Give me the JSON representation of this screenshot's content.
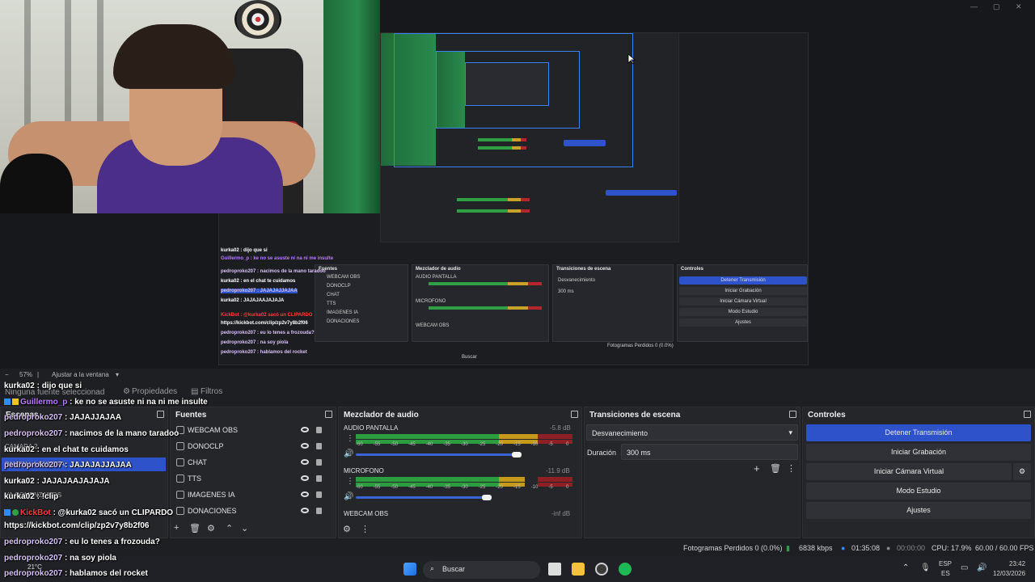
{
  "window": {
    "min": "—",
    "max": "▢",
    "close": "✕"
  },
  "zoom": {
    "level": "57%",
    "fit_label": "Ajustar a la ventana"
  },
  "tabs": {
    "properties": "Propiedades",
    "filters": "Filtros",
    "no_source": "Ninguna fuente seleccionad"
  },
  "docks": {
    "scenes": "Escenas",
    "sources": "Fuentes",
    "mixer": "Mezclador de audio",
    "transitions": "Transiciones de escena",
    "controls": "Controles"
  },
  "scenes_ghost": [
    "CAMARA 2",
    "PANTALLA ENTERA",
    "YA COMENZAMOS"
  ],
  "sources": [
    {
      "name": "WEBCAM OBS"
    },
    {
      "name": "DONOCLP"
    },
    {
      "name": "CHAT"
    },
    {
      "name": "TTS"
    },
    {
      "name": "IMAGENES IA"
    },
    {
      "name": "DONACIONES"
    }
  ],
  "mixer": {
    "channels": [
      {
        "name": "AUDIO PANTALLA",
        "db": "-5.8 dB",
        "level": 0.88
      },
      {
        "name": "MICROFONO",
        "db": "-11.9 dB",
        "level": 0.78
      },
      {
        "name": "WEBCAM OBS",
        "db": "-inf dB",
        "level": 0
      }
    ],
    "scale": [
      "-60",
      "-55",
      "-50",
      "-45",
      "-40",
      "-35",
      "-30",
      "-25",
      "-20",
      "-15",
      "-10",
      "-5",
      "0"
    ]
  },
  "transitions": {
    "type": "Desvanecimiento",
    "duration_label": "Duración",
    "duration": "300 ms"
  },
  "controls": {
    "stop_stream": "Detener Transmisión",
    "start_rec": "Iniciar Grabación",
    "virtual_cam": "Iniciar Cámara Virtual",
    "studio": "Modo Estudio",
    "settings": "Ajustes"
  },
  "status": {
    "dropped": "Fotogramas Perdidos 0 (0.0%)",
    "kbps": "6838 kbps",
    "stream_time": "01:35:08",
    "rec_time": "00:00:00",
    "cpu": "CPU: 17.9%",
    "fps": "60.00 / 60.00 FPS"
  },
  "taskbar": {
    "search": "Buscar",
    "weather": "21°C",
    "lang1": "ESP",
    "lang2": "ES",
    "time": "23:42",
    "date": "12/03/2026"
  },
  "chat": [
    {
      "user": "kurka02",
      "msg": ": dijo que si",
      "color": "white"
    },
    {
      "user": "Guillermo_p",
      "msg": ": ke no se asuste ni na ni me insulte",
      "color": "purple",
      "badges": true
    },
    {
      "user": "pedroproko207",
      "msg": ": JAJAJJAJAA",
      "color": "lilac"
    },
    {
      "user": "pedroproko207",
      "msg": ": nacimos de la mano taradoo",
      "color": "lilac"
    },
    {
      "user": "kurka02",
      "msg": ": en el chat te cuidamos",
      "color": "white"
    },
    {
      "user": "pedroproko207",
      "msg": ": JAJAJAJJAJAA",
      "color": "lilac"
    },
    {
      "user": "kurka02",
      "msg": ": JAJAJAAJAJAJA",
      "color": "white"
    },
    {
      "user": "kurka02",
      "msg": ": !clip",
      "color": "white"
    },
    {
      "user": "KickBot",
      "msg": ": @kurka02 sacó un CLIPARDO",
      "color": "red",
      "badges": true
    },
    {
      "user": "",
      "msg": "https://kickbot.com/clip/zp2v7y8b2f06",
      "color": "white"
    },
    {
      "user": "pedroproko207",
      "msg": ": eu lo tenes a frozouda?",
      "color": "lilac"
    },
    {
      "user": "pedroproko207",
      "msg": ": na soy piola",
      "color": "lilac"
    },
    {
      "user": "pedroproko207",
      "msg": ": hablamos del rocket",
      "color": "lilac"
    }
  ],
  "nested_chat": [
    "kurka02 : dijo que si",
    "Guillermo_p : ke no se asuste ni na ni me insulte",
    "pedroproko207 : nacimos de la mano taradoo",
    "kurka02 : en el chat te cuidamos",
    "pedroproko207 : JAJAJAJJAJAA",
    "kurka02 : JAJAJAAJAJAJA",
    "KickBot : @kurka02 sacó un CLIPARDO",
    "https://kickbot.com/clip/zp2v7y8b2f06",
    "pedroproko207 : eu lo tenes a frozouda?",
    "pedroproko207 : na soy piola",
    "pedroproko207 : hablamos del rocket"
  ],
  "colors": {
    "accent": "#2d52c9",
    "panel": "#25262a",
    "bg": "#1e1f22"
  }
}
